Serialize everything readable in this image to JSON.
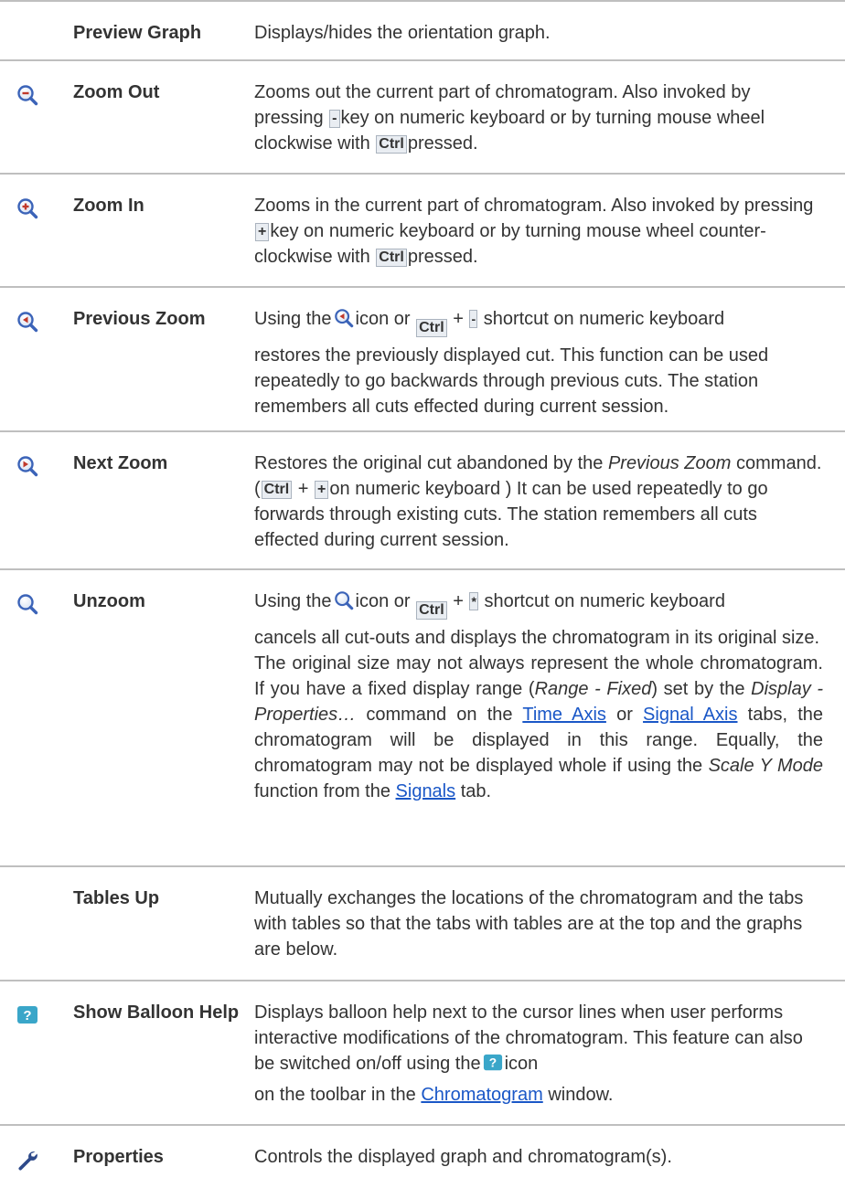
{
  "rows": [
    {
      "name": "Preview Graph",
      "desc": "Displays/hides the orientation graph."
    },
    {
      "name": "Zoom Out",
      "desc_a": "Zooms out the current part of chromatogram. Also invoked by pressing",
      "key1": "-",
      "desc_b": "key on numeric keyboard or by turning mouse wheel clockwise with",
      "key2": "Ctrl",
      "desc_c": "pressed."
    },
    {
      "name": "Zoom In",
      "desc_a": "Zooms in the current part of chromatogram. Also invoked by pressing",
      "key1": "+",
      "desc_b": "key on numeric keyboard or by turning mouse wheel counter-clockwise with",
      "key2": "Ctrl",
      "desc_c": "pressed."
    },
    {
      "name": "Previous Zoom",
      "desc_a": "Using the",
      "desc_b": "icon or",
      "key1": "Ctrl",
      "plus": "+",
      "key2": "-",
      "desc_c": "shortcut on numeric keyboard",
      "desc_d": "restores the previously displayed cut. This function can be used repeatedly to go backwards through previous cuts. The station remembers all cuts effected during current session."
    },
    {
      "name": "Next Zoom",
      "desc_a": "Restores the original cut abandoned by the",
      "em1": "Previous Zoom",
      "desc_b": "command. (",
      "key1": "Ctrl",
      "plus": "+",
      "key2": "+",
      "desc_c": "on numeric keyboard ) It can be used repeatedly to go forwards through existing cuts. The station remembers all cuts effected during current session."
    },
    {
      "name": "Unzoom",
      "desc_a": "Using the",
      "desc_b": "icon or",
      "key1": "Ctrl",
      "plus": "+",
      "key2": "*",
      "desc_c": "shortcut on numeric keyboard",
      "desc_d": "cancels all cut-outs and displays the chromatogram in its original size.",
      "p2_a": "The original size may not always represent the whole chromatogram. If you have a fixed display range (",
      "p2_em1": "Range - Fixed",
      "p2_b": ") set by the",
      "p2_em2": "Display - Properties…",
      "p2_c": "command on the",
      "p2_link1": "Time Axis",
      "p2_d": "or",
      "p2_link2": "Signal Axis",
      "p2_e": "tabs, the chromatogram will be displayed in this range. Equally, the chromatogram may not be displayed whole if using the",
      "p2_em3": "Scale Y Mode",
      "p2_f": "function from the",
      "p2_link3": "Signals",
      "p2_g": "tab."
    },
    {
      "name": "Tables Up",
      "desc": "Mutually exchanges the locations of the chromatogram and the tabs with tables so that the tabs with tables are at the top and the graphs are below."
    },
    {
      "name": "Show Balloon Help",
      "desc_a": "Displays balloon help next to the cursor lines when user performs interactive modifications of the chromatogram. This feature can also be switched on/off using the",
      "desc_b": "icon",
      "desc_c": "on the toolbar in the",
      "link": "Chromatogram",
      "desc_d": "window."
    },
    {
      "name": "Properties",
      "desc": "Controls the displayed graph and chromatogram(s)."
    }
  ],
  "colors": {
    "icon_blue": "#3b63b8",
    "icon_red": "#c0392b",
    "help_teal": "#3aa6c9",
    "link": "#1a57c7",
    "rule": "#bfbfbf"
  }
}
